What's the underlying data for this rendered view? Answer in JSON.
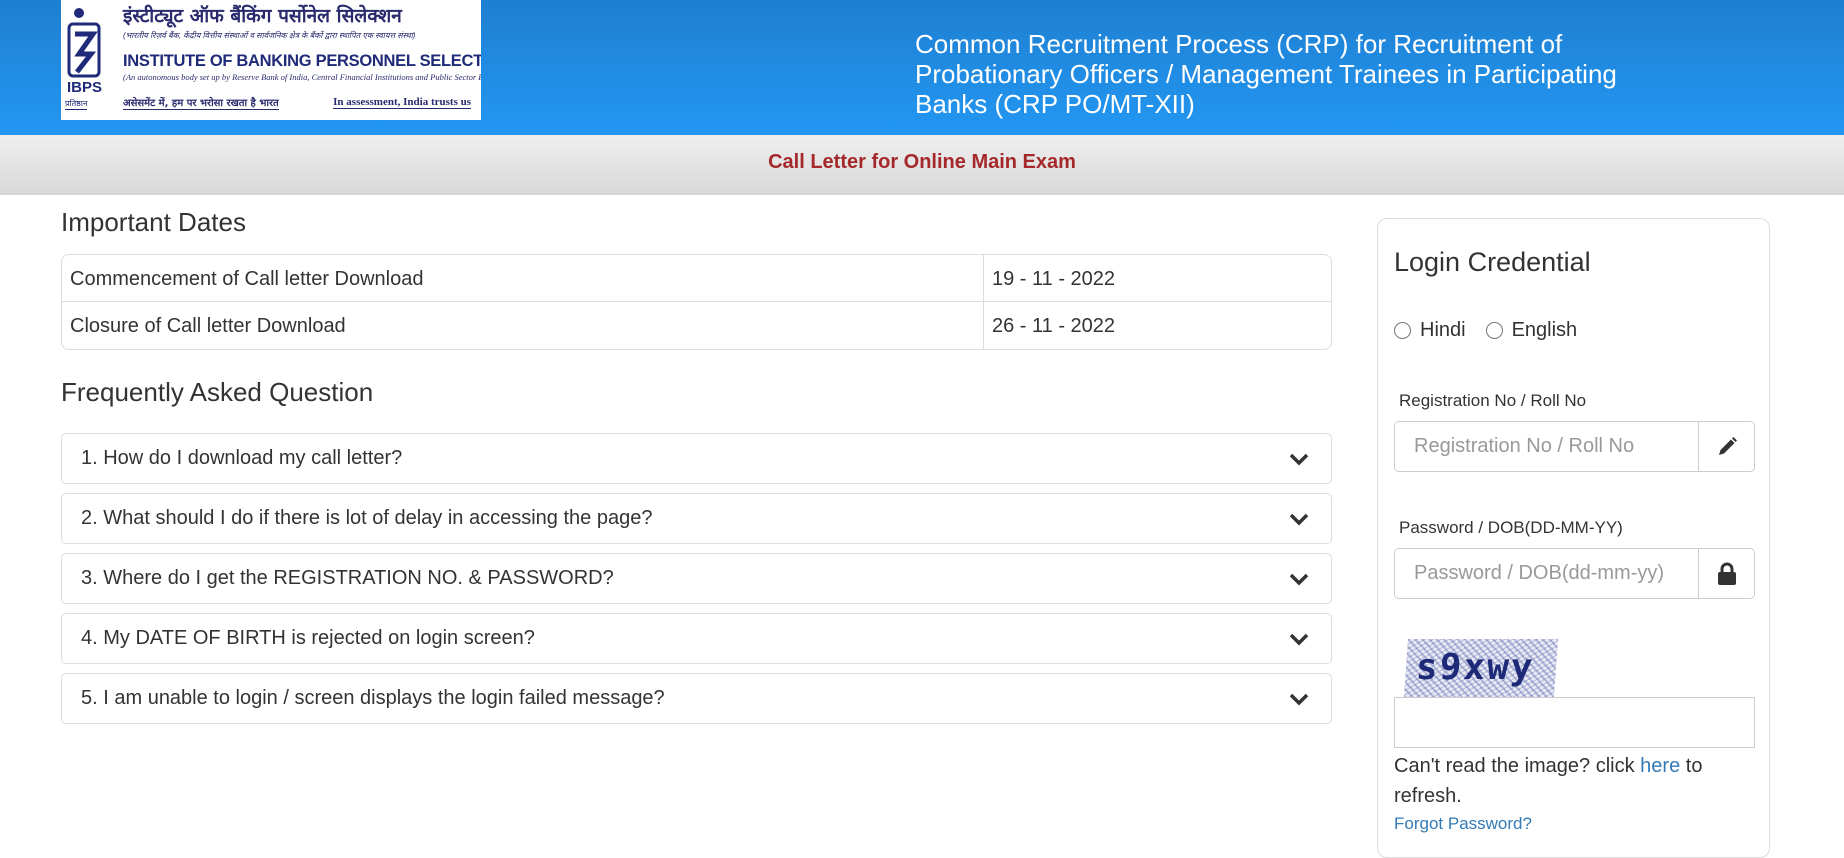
{
  "header": {
    "logo": {
      "hindi_title": "इंस्टीट्यूट ऑफ बैंकिंग पर्सोनेल सिलेक्शन",
      "hindi_subtitle": "(भारतीय रिज़र्व बैंक, केंद्रीय वित्तीय संस्थाओं व सार्वजनिक क्षेत्र के बैंकों द्वारा स्थापित एक स्वायत्त संस्था)",
      "english_title": "INSTITUTE OF BANKING PERSONNEL SELECTION",
      "english_subtitle": "(An autonomous body set up by Reserve Bank of India, Central Financial Institutions and Public Sector Banks)",
      "hindi_tagline": "असेसमेंट में, हम पर भरोसा रखता है भारत",
      "english_tagline": "In assessment, India trusts us",
      "abbr": "IBPS",
      "abbr_hindi": "प्रतिष्ठान"
    },
    "title": "Common Recruitment Process (CRP) for Recruitment of Probationary Officers / Management Trainees in Participating Banks (CRP PO/MT-XII)"
  },
  "subbar": {
    "title": "Call Letter for Online Main Exam"
  },
  "important_dates": {
    "heading": "Important Dates",
    "rows": [
      {
        "label": "Commencement of Call letter Download",
        "value": "19 - 11 - 2022"
      },
      {
        "label": "Closure of Call letter Download",
        "value": "26 - 11 - 2022"
      }
    ]
  },
  "faq": {
    "heading": "Frequently Asked Question",
    "items": [
      {
        "question": "1. How do I download my call letter?",
        "icon": "chevron-down-icon"
      },
      {
        "question": "2. What should I do if there is lot of delay in accessing the page?",
        "icon": "chevron-down-icon"
      },
      {
        "question": "3. Where do I get the REGISTRATION NO. & PASSWORD?",
        "icon": "chevron-down-icon"
      },
      {
        "question": "4. My DATE OF BIRTH is rejected on login screen?",
        "icon": "chevron-down-icon"
      },
      {
        "question": "5. I am unable to login / screen displays the login failed message?",
        "icon": "chevron-down-icon"
      }
    ]
  },
  "login": {
    "title": "Login Credential",
    "languages": [
      {
        "label": "Hindi",
        "selected": false
      },
      {
        "label": "English",
        "selected": false
      }
    ],
    "registration": {
      "label": "Registration No / Roll No",
      "placeholder": "Registration No / Roll No",
      "value": "",
      "icon": "pencil-icon"
    },
    "password": {
      "label": "Password / DOB(DD-MM-YY)",
      "placeholder": "Password / DOB(dd-mm-yy)",
      "value": "",
      "icon": "lock-icon"
    },
    "captcha": {
      "text": "s9xwy",
      "input_value": ""
    },
    "refresh": {
      "prefix": "Can't read the image? click ",
      "link": "here",
      "suffix": " to refresh."
    },
    "forgot_password": "Forgot Password?"
  },
  "colors": {
    "header_top": "#1e7fd0",
    "header_bottom": "#2397f3",
    "subbar_title": "#a5282b",
    "link": "#337ab7",
    "text": "#333333"
  }
}
